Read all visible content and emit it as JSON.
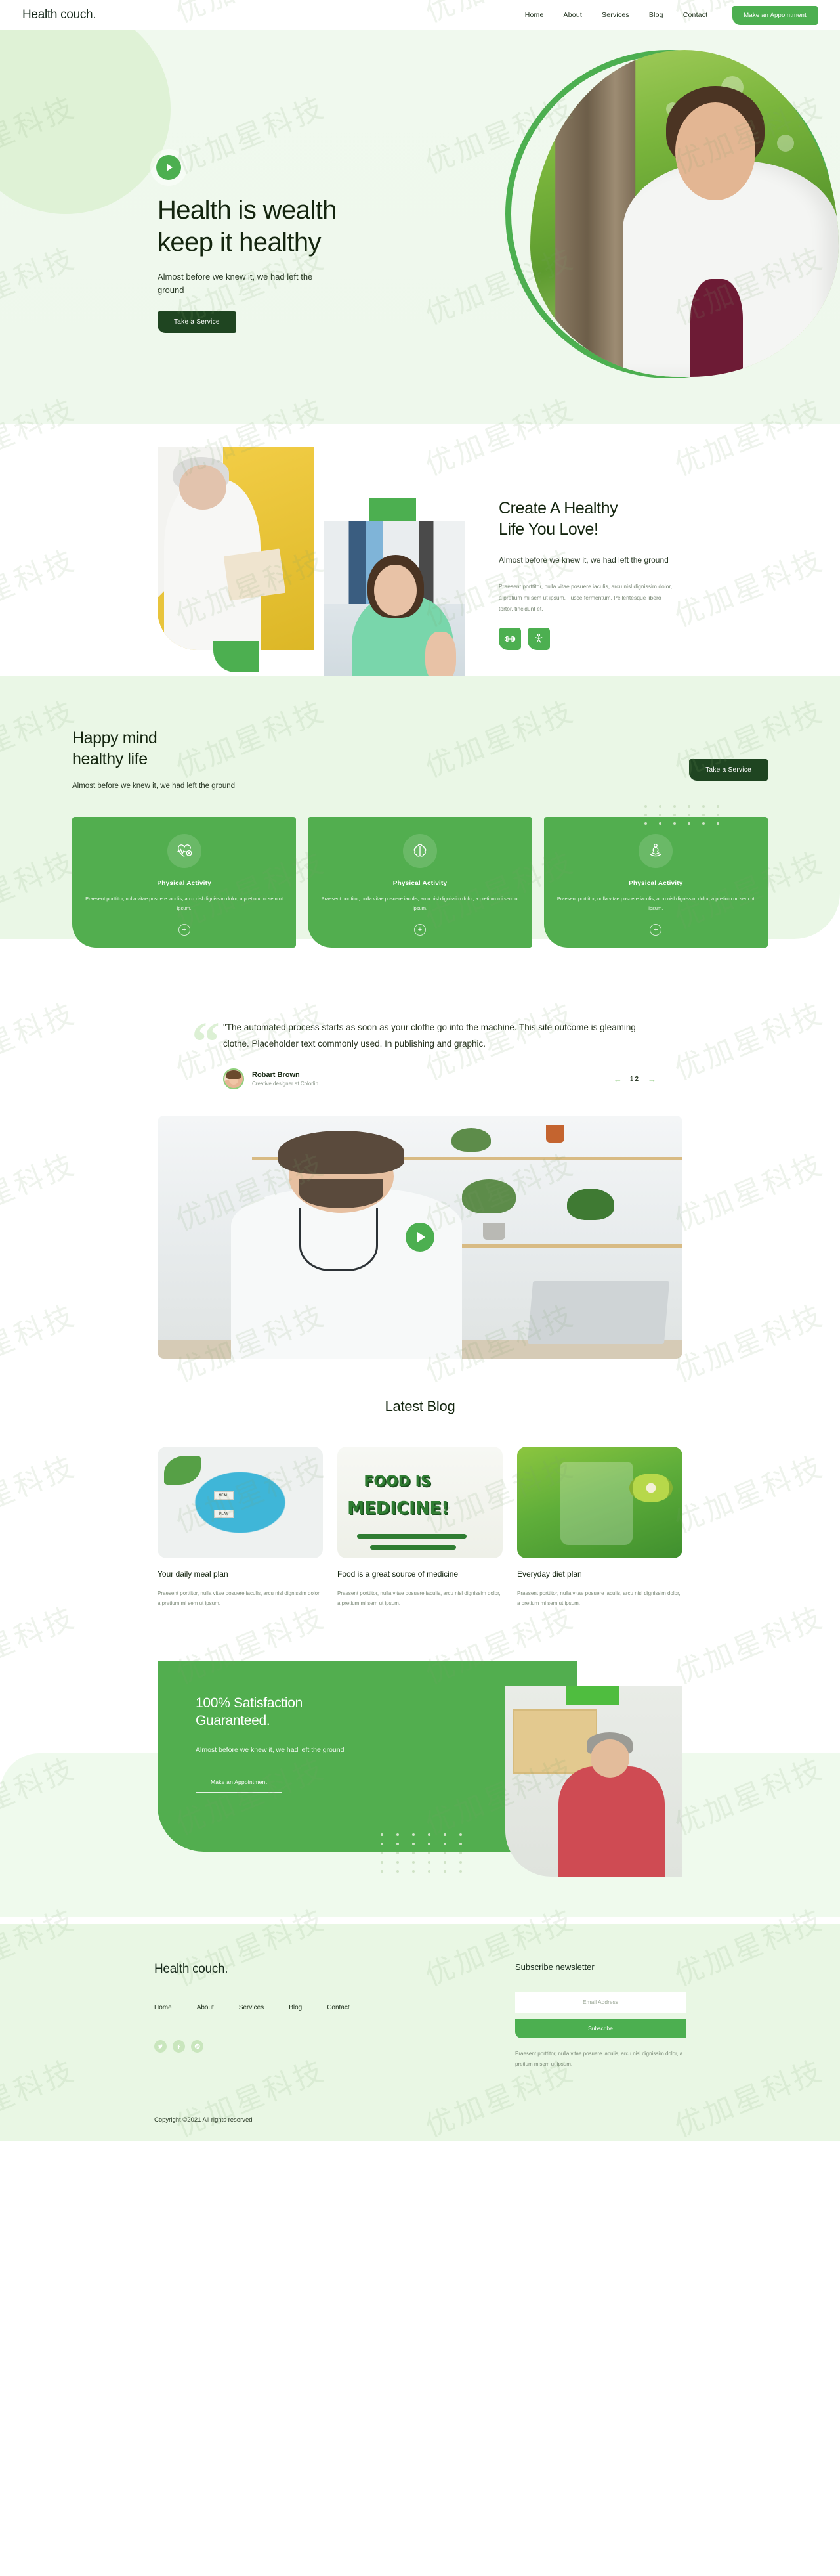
{
  "header": {
    "brand": "Health couch.",
    "nav": [
      "Home",
      "About",
      "Services",
      "Blog",
      "Contact"
    ],
    "cta": "Make an Appointment"
  },
  "hero": {
    "title_line1": "Health is wealth",
    "title_line2": "keep it healthy",
    "subtitle": "Almost before we knew it, we had left the ground",
    "button": "Take a Service"
  },
  "create": {
    "title_line1": "Create A Healthy",
    "title_line2": "Life You Love!",
    "lead": "Almost before we knew it, we had left the ground",
    "body": "Praesent porttitor, nulla vitae posuere iaculis, arcu nisl dignissim dolor, a pretium mi sem ut ipsum. Fusce fermentum. Pellentesque libero tortor, tincidunt et."
  },
  "happy": {
    "title_line1": "Happy mind",
    "title_line2": "healthy life",
    "subtitle": "Almost before we knew it, we had left the ground",
    "button": "Take a Service",
    "cards": [
      {
        "icon": "heartbeat-plus-icon",
        "title": "Physical Activity",
        "text": "Praesent porttitor, nulla vitae posuere iaculis, arcu nisl dignissim dolor, a pretium mi sem ut ipsum.",
        "more": "+"
      },
      {
        "icon": "brain-icon",
        "title": "Physical Activity",
        "text": "Praesent porttitor, nulla vitae posuere iaculis, arcu nisl dignissim dolor, a pretium mi sem ut ipsum.",
        "more": "+"
      },
      {
        "icon": "meditation-icon",
        "title": "Physical Activity",
        "text": "Praesent porttitor, nulla vitae posuere iaculis, arcu nisl dignissim dolor, a pretium mi sem ut ipsum.",
        "more": "+"
      }
    ]
  },
  "testimonial": {
    "quote": "\"The automated process starts as soon as your clothe go into the machine. This site outcome is gleaming clothe. Placeholder text commonly used. In publishing and graphic.",
    "name": "Robart Brown",
    "role": "Creative designer at Colorlib",
    "prev": "←",
    "next": "→",
    "page_current": "1",
    "page_total": "2"
  },
  "blog": {
    "title": "Latest Blog",
    "posts": [
      {
        "thumb_label_1": "MEAL",
        "thumb_label_2": "PLAN",
        "title": "Your daily meal plan",
        "text": "Praesent porttitor, nulla vitae posuere iaculis, arcu nisl dignissim dolor, a pretium mi sem ut ipsum."
      },
      {
        "thumb_label_1": "FOOD IS",
        "thumb_label_2": "MEDICINE!",
        "title": "Food is a great source of medicine",
        "text": "Praesent porttitor, nulla vitae posuere iaculis, arcu nisl dignissim dolor, a pretium mi sem ut ipsum."
      },
      {
        "thumb_label_1": "",
        "thumb_label_2": "",
        "title": "Everyday diet plan",
        "text": "Praesent porttitor, nulla vitae posuere iaculis, arcu nisl dignissim dolor, a pretium mi sem ut ipsum."
      }
    ]
  },
  "satisfaction": {
    "title_line1": "100% Satisfaction",
    "title_line2": "Guaranteed.",
    "subtitle": "Almost before we knew it, we had left the ground",
    "button": "Make an Appointment"
  },
  "footer": {
    "brand": "Health couch.",
    "nav": [
      "Home",
      "About",
      "Services",
      "Blog",
      "Contact"
    ],
    "socials": [
      "twitter-icon",
      "facebook-icon",
      "pinterest-icon"
    ],
    "newsletter_title": "Subscribe newsletter",
    "email_placeholder": "Email Address",
    "subscribe_button": "Subscribe",
    "newsletter_note": "Praesent porttitor, nulla vitae posuere iaculis, arcu nisl dignissim dolor, a pretium misem ut ipsum.",
    "copyright": "Copyright ©2021 All rights reserved"
  },
  "watermark": {
    "text": "优加星科技"
  },
  "colors": {
    "accent": "#4caf50",
    "accent_dark": "#1f4521",
    "card_green": "#52ae4f",
    "tint": "#eaf7e6",
    "hero_tint": "#f0f9ee"
  }
}
